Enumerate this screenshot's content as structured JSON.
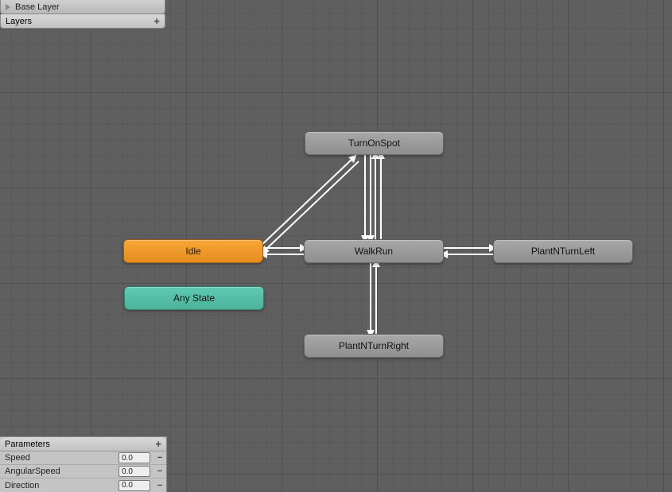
{
  "tab": {
    "label": "Base Layer"
  },
  "layers_header": {
    "label": "Layers"
  },
  "nodes": {
    "idle": {
      "label": "Idle"
    },
    "turn_on_spot": {
      "label": "TurnOnSpot"
    },
    "walk_run": {
      "label": "WalkRun"
    },
    "plant_n_turn_left": {
      "label": "PlantNTurnLeft"
    },
    "plant_n_turn_right": {
      "label": "PlantNTurnRight"
    },
    "any_state": {
      "label": "Any State"
    }
  },
  "parameters": {
    "header": "Parameters",
    "items": [
      {
        "name": "Speed",
        "value": "0.0"
      },
      {
        "name": "AngularSpeed",
        "value": "0.0"
      },
      {
        "name": "Direction",
        "value": "0.0"
      }
    ]
  }
}
